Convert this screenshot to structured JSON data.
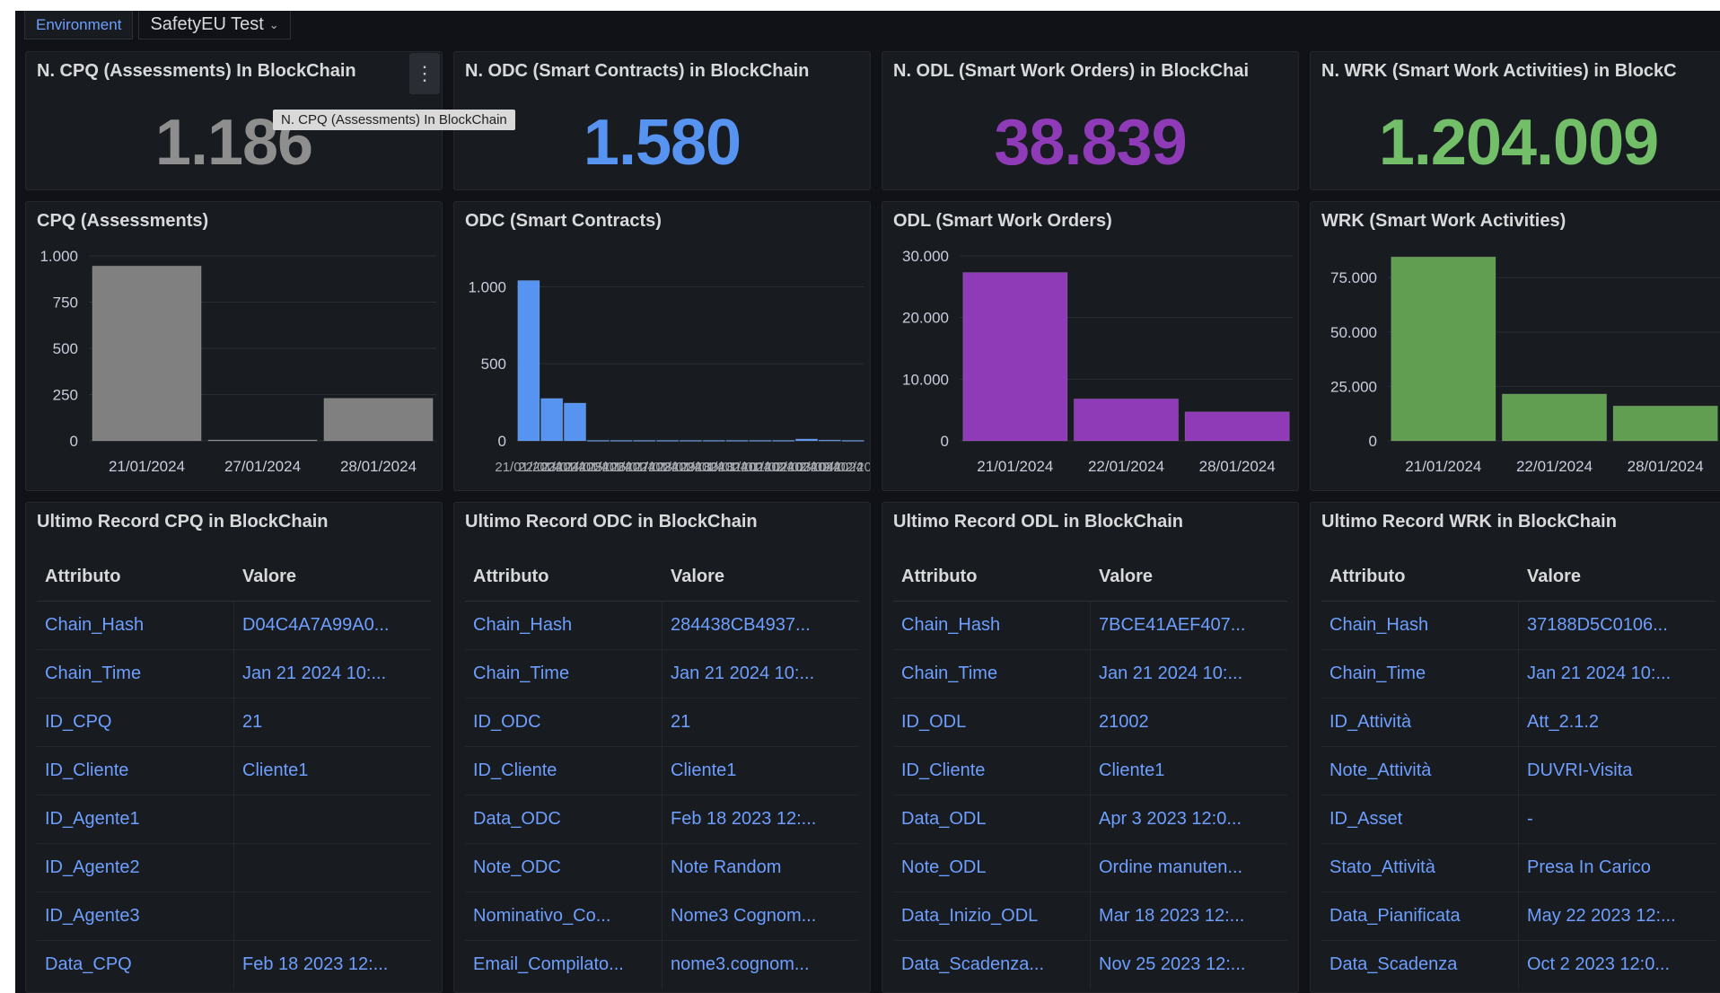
{
  "variables": {
    "label": "Environment",
    "value": "SafetyEU Test"
  },
  "tooltip": "N. CPQ (Assessments) In BlockChain",
  "stats": [
    {
      "title": "N. CPQ (Assessments) In BlockChain",
      "value": "1.186",
      "color": "#8e8e8e"
    },
    {
      "title": "N. ODC (Smart Contracts) in BlockChain",
      "value": "1.580",
      "color": "#5794f2"
    },
    {
      "title": "N. ODL (Smart Work Orders) in BlockChai",
      "value": "38.839",
      "color": "#8f3bb8"
    },
    {
      "title": "N. WRK (Smart Work Activities) in BlockC",
      "value": "1.204.009",
      "color": "#73bf69"
    }
  ],
  "charts": [
    {
      "title": "CPQ (Assessments)",
      "color": "#808080",
      "chart_data": {
        "type": "bar",
        "title": "CPQ (Assessments)",
        "categories": [
          "21/01/2024",
          "27/01/2024",
          "28/01/2024"
        ],
        "values": [
          945,
          5,
          230
        ],
        "ylim": [
          0,
          1000
        ],
        "yticks": [
          0,
          250,
          500,
          750,
          1000
        ],
        "ytick_labels": [
          "0",
          "250",
          "500",
          "750",
          "1.000"
        ],
        "grid": true
      }
    },
    {
      "title": "ODC (Smart Contracts)",
      "color": "#5794f2",
      "chart_data": {
        "type": "bar",
        "title": "ODC (Smart Contracts)",
        "categories": [
          "21/01/2024",
          "22/01/2024",
          "23/01/2024",
          "24/01/2024",
          "25/01/2024",
          "26/01/2024",
          "27/01/2024",
          "28/01/2024",
          "29/01/2024",
          "30/01/2024",
          "31/01/2024",
          "01/02/2024",
          "02/02/2024",
          "03/02/2024",
          "04/02/2024"
        ],
        "values": [
          1040,
          275,
          245,
          3,
          3,
          3,
          3,
          3,
          3,
          3,
          3,
          3,
          12,
          5,
          3
        ],
        "ylim": [
          0,
          1200
        ],
        "yticks": [
          0,
          500,
          1000
        ],
        "ytick_labels": [
          "0",
          "500",
          "1.000"
        ],
        "grid": true
      }
    },
    {
      "title": "ODL (Smart Work Orders)",
      "color": "#8f3bb8",
      "chart_data": {
        "type": "bar",
        "title": "ODL (Smart Work Orders)",
        "categories": [
          "21/01/2024",
          "22/01/2024",
          "28/01/2024"
        ],
        "values": [
          27300,
          6800,
          4700
        ],
        "ylim": [
          0,
          30000
        ],
        "yticks": [
          0,
          10000,
          20000,
          30000
        ],
        "ytick_labels": [
          "0",
          "10.000",
          "20.000",
          "30.000"
        ],
        "grid": true
      }
    },
    {
      "title": "WRK (Smart Work Activities)",
      "color": "#629e51",
      "chart_data": {
        "type": "bar",
        "title": "WRK (Smart Work Activities)",
        "categories": [
          "21/01/2024",
          "22/01/2024",
          "28/01/2024"
        ],
        "values": [
          84500,
          21500,
          16000
        ],
        "ylim": [
          0,
          85000
        ],
        "yticks": [
          0,
          25000,
          50000,
          75000
        ],
        "ytick_labels": [
          "0",
          "25.000",
          "50.000",
          "75.000"
        ],
        "grid": true
      }
    }
  ],
  "tables": [
    {
      "title": "Ultimo Record CPQ in BlockChain",
      "header": [
        "Attributo",
        "Valore"
      ],
      "rows": [
        [
          "Chain_Hash",
          "D04C4A7A99A0..."
        ],
        [
          "Chain_Time",
          "Jan 21 2024 10:..."
        ],
        [
          "ID_CPQ",
          "21"
        ],
        [
          "ID_Cliente",
          "Cliente1"
        ],
        [
          "ID_Agente1",
          ""
        ],
        [
          "ID_Agente2",
          ""
        ],
        [
          "ID_Agente3",
          ""
        ],
        [
          "Data_CPQ",
          "Feb 18 2023 12:..."
        ]
      ]
    },
    {
      "title": "Ultimo Record ODC in BlockChain",
      "header": [
        "Attributo",
        "Valore"
      ],
      "rows": [
        [
          "Chain_Hash",
          "284438CB4937..."
        ],
        [
          "Chain_Time",
          "Jan 21 2024 10:..."
        ],
        [
          "ID_ODC",
          "21"
        ],
        [
          "ID_Cliente",
          "Cliente1"
        ],
        [
          "Data_ODC",
          "Feb 18 2023 12:..."
        ],
        [
          "Note_ODC",
          "Note Random"
        ],
        [
          "Nominativo_Co...",
          "Nome3 Cognom..."
        ],
        [
          "Email_Compilato...",
          "nome3.cognom..."
        ]
      ]
    },
    {
      "title": "Ultimo Record ODL in BlockChain",
      "header": [
        "Attributo",
        "Valore"
      ],
      "rows": [
        [
          "Chain_Hash",
          "7BCE41AEF407..."
        ],
        [
          "Chain_Time",
          "Jan 21 2024 10:..."
        ],
        [
          "ID_ODL",
          "21002"
        ],
        [
          "ID_Cliente",
          "Cliente1"
        ],
        [
          "Data_ODL",
          "Apr 3 2023 12:0..."
        ],
        [
          "Note_ODL",
          "Ordine manuten..."
        ],
        [
          "Data_Inizio_ODL",
          "Mar 18 2023 12:..."
        ],
        [
          "Data_Scadenza...",
          "Nov 25 2023 12:..."
        ]
      ]
    },
    {
      "title": "Ultimo Record WRK in BlockChain",
      "header": [
        "Attributo",
        "Valore"
      ],
      "rows": [
        [
          "Chain_Hash",
          "37188D5C0106..."
        ],
        [
          "Chain_Time",
          "Jan 21 2024 10:..."
        ],
        [
          "ID_Attività",
          "Att_2.1.2"
        ],
        [
          "Note_Attività",
          "DUVRI-Visita"
        ],
        [
          "ID_Asset",
          "-"
        ],
        [
          "Stato_Attività",
          "Presa In Carico"
        ],
        [
          "Data_Pianificata",
          "May 22 2023 12:..."
        ],
        [
          "Data_Scadenza",
          "Oct 2 2023 12:0..."
        ]
      ]
    }
  ]
}
